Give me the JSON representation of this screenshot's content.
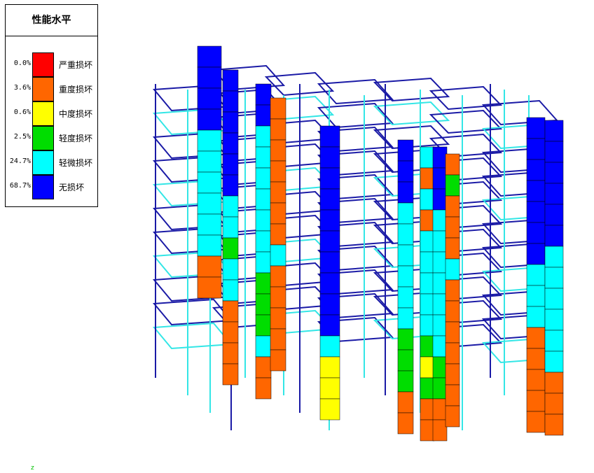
{
  "legend": {
    "title": "性能水平",
    "items": [
      {
        "label": "严重损坏",
        "percent": "0.0%",
        "color": "#ff0000"
      },
      {
        "label": "重度损坏",
        "percent": "3.6%",
        "color": "#ff6600"
      },
      {
        "label": "中度损坏",
        "percent": "0.6%",
        "color": "#ffff00"
      },
      {
        "label": "轻度损坏",
        "percent": "2.5%",
        "color": "#00dd00"
      },
      {
        "label": "轻微损坏",
        "percent": "24.7%",
        "color": "#00ffff"
      },
      {
        "label": "无损坏",
        "percent": "68.7%",
        "color": "#0000ff"
      }
    ]
  },
  "axis_mark": "z",
  "colors": {
    "frame_blue": "#1a1aa6",
    "frame_cyan": "#33e6e6",
    "grid_line": "#000000"
  }
}
